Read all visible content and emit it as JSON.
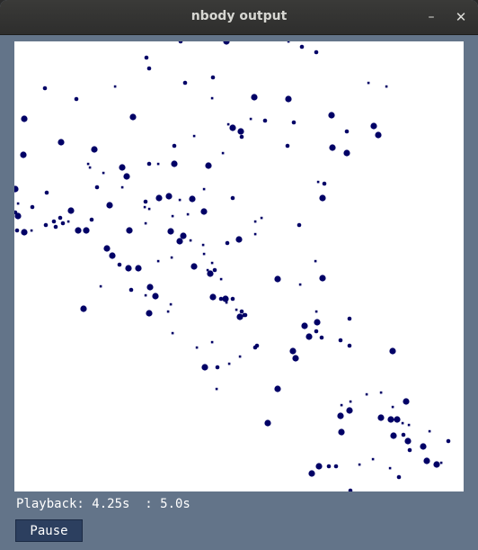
{
  "window": {
    "title": "nbody output",
    "minimize_glyph": "–",
    "close_glyph": "✕"
  },
  "simulation": {
    "body_color": "#000066",
    "bodies": [
      [
        185,
        0,
        2
      ],
      [
        236,
        0,
        3
      ],
      [
        305,
        0,
        1
      ],
      [
        320,
        6,
        2
      ],
      [
        336,
        12,
        2
      ],
      [
        147,
        18,
        2
      ],
      [
        150,
        30,
        2
      ],
      [
        221,
        40,
        2
      ],
      [
        190,
        46,
        2
      ],
      [
        34,
        52,
        2
      ],
      [
        112,
        50,
        1
      ],
      [
        69,
        64,
        2
      ],
      [
        267,
        62,
        3
      ],
      [
        305,
        64,
        3
      ],
      [
        220,
        63,
        1
      ],
      [
        11,
        86,
        3
      ],
      [
        311,
        90,
        2
      ],
      [
        132,
        84,
        3
      ],
      [
        279,
        88,
        2
      ],
      [
        263,
        86,
        1
      ],
      [
        238,
        92,
        1
      ],
      [
        243,
        96,
        3
      ],
      [
        252,
        100,
        3
      ],
      [
        400,
        94,
        3
      ],
      [
        405,
        104,
        3
      ],
      [
        394,
        46,
        1
      ],
      [
        414,
        50,
        1
      ],
      [
        370,
        100,
        2
      ],
      [
        353,
        82,
        3
      ],
      [
        354,
        118,
        3
      ],
      [
        253,
        106,
        2
      ],
      [
        52,
        112,
        3
      ],
      [
        89,
        120,
        3
      ],
      [
        10,
        126,
        3
      ],
      [
        178,
        116,
        2
      ],
      [
        200,
        105,
        1
      ],
      [
        216,
        138,
        3
      ],
      [
        232,
        124,
        1
      ],
      [
        304,
        116,
        2
      ],
      [
        370,
        124,
        3
      ],
      [
        82,
        136,
        1
      ],
      [
        84,
        140,
        1
      ],
      [
        120,
        140,
        3
      ],
      [
        150,
        136,
        2
      ],
      [
        125,
        150,
        3
      ],
      [
        160,
        136,
        1
      ],
      [
        178,
        136,
        3
      ],
      [
        99,
        146,
        1
      ],
      [
        92,
        162,
        2
      ],
      [
        120,
        162,
        1
      ],
      [
        36,
        168,
        2
      ],
      [
        1,
        164,
        3
      ],
      [
        211,
        164,
        1
      ],
      [
        243,
        174,
        2
      ],
      [
        338,
        156,
        1
      ],
      [
        345,
        158,
        2
      ],
      [
        343,
        174,
        3
      ],
      [
        106,
        182,
        3
      ],
      [
        146,
        178,
        2
      ],
      [
        161,
        174,
        3
      ],
      [
        145,
        184,
        1
      ],
      [
        150,
        186,
        1
      ],
      [
        172,
        172,
        3
      ],
      [
        184,
        176,
        1
      ],
      [
        198,
        175,
        3
      ],
      [
        4,
        180,
        1
      ],
      [
        20,
        184,
        2
      ],
      [
        63,
        188,
        3
      ],
      [
        86,
        198,
        2
      ],
      [
        176,
        194,
        1
      ],
      [
        193,
        192,
        1
      ],
      [
        211,
        189,
        3
      ],
      [
        268,
        200,
        1
      ],
      [
        275,
        196,
        1
      ],
      [
        317,
        204,
        2
      ],
      [
        1,
        190,
        2
      ],
      [
        4,
        194,
        3
      ],
      [
        44,
        200,
        2
      ],
      [
        51,
        196,
        2
      ],
      [
        3,
        210,
        2
      ],
      [
        11,
        212,
        3
      ],
      [
        19,
        210,
        1
      ],
      [
        35,
        204,
        2
      ],
      [
        46,
        206,
        2
      ],
      [
        54,
        202,
        2
      ],
      [
        60,
        200,
        1
      ],
      [
        71,
        210,
        3
      ],
      [
        80,
        210,
        3
      ],
      [
        128,
        210,
        3
      ],
      [
        146,
        202,
        1
      ],
      [
        174,
        211,
        3
      ],
      [
        184,
        222,
        3
      ],
      [
        188,
        216,
        3
      ],
      [
        196,
        221,
        1
      ],
      [
        210,
        226,
        1
      ],
      [
        237,
        224,
        2
      ],
      [
        250,
        220,
        3
      ],
      [
        268,
        214,
        1
      ],
      [
        103,
        230,
        3
      ],
      [
        109,
        238,
        3
      ],
      [
        117,
        248,
        2
      ],
      [
        127,
        252,
        3
      ],
      [
        138,
        252,
        3
      ],
      [
        160,
        244,
        1
      ],
      [
        175,
        240,
        1
      ],
      [
        200,
        250,
        3
      ],
      [
        211,
        236,
        1
      ],
      [
        220,
        246,
        1
      ],
      [
        215,
        254,
        1
      ],
      [
        218,
        258,
        3
      ],
      [
        223,
        254,
        2
      ],
      [
        230,
        264,
        1
      ],
      [
        293,
        264,
        3
      ],
      [
        318,
        270,
        1
      ],
      [
        335,
        244,
        1
      ],
      [
        343,
        263,
        3
      ],
      [
        96,
        272,
        1
      ],
      [
        130,
        276,
        2
      ],
      [
        151,
        273,
        3
      ],
      [
        157,
        283,
        3
      ],
      [
        146,
        282,
        1
      ],
      [
        221,
        284,
        3
      ],
      [
        230,
        286,
        2
      ],
      [
        235,
        286,
        3
      ],
      [
        243,
        286,
        2
      ],
      [
        77,
        297,
        3
      ],
      [
        150,
        302,
        3
      ],
      [
        171,
        300,
        1
      ],
      [
        174,
        292,
        1
      ],
      [
        236,
        290,
        1
      ],
      [
        247,
        298,
        1
      ],
      [
        251,
        306,
        3
      ],
      [
        253,
        300,
        2
      ],
      [
        257,
        304,
        2
      ],
      [
        336,
        300,
        1
      ],
      [
        337,
        312,
        3
      ],
      [
        373,
        308,
        2
      ],
      [
        176,
        324,
        1
      ],
      [
        203,
        340,
        1
      ],
      [
        220,
        334,
        1
      ],
      [
        256,
        304,
        2
      ],
      [
        323,
        316,
        3
      ],
      [
        336,
        322,
        2
      ],
      [
        328,
        328,
        3
      ],
      [
        342,
        329,
        2
      ],
      [
        363,
        332,
        2
      ],
      [
        373,
        338,
        2
      ],
      [
        268,
        340,
        2
      ],
      [
        251,
        350,
        1
      ],
      [
        226,
        362,
        2
      ],
      [
        239,
        358,
        1
      ],
      [
        270,
        338,
        2
      ],
      [
        310,
        344,
        3
      ],
      [
        313,
        352,
        3
      ],
      [
        421,
        344,
        3
      ],
      [
        212,
        362,
        3
      ],
      [
        225,
        386,
        1
      ],
      [
        293,
        386,
        3
      ],
      [
        282,
        424,
        3
      ],
      [
        421,
        406,
        1
      ],
      [
        436,
        400,
        3
      ],
      [
        392,
        392,
        1
      ],
      [
        408,
        390,
        1
      ],
      [
        408,
        418,
        3
      ],
      [
        364,
        404,
        1
      ],
      [
        363,
        416,
        3
      ],
      [
        373,
        410,
        3
      ],
      [
        374,
        400,
        1
      ],
      [
        419,
        420,
        3
      ],
      [
        426,
        420,
        3
      ],
      [
        432,
        424,
        1
      ],
      [
        439,
        426,
        1
      ],
      [
        422,
        438,
        3
      ],
      [
        433,
        437,
        2
      ],
      [
        438,
        444,
        3
      ],
      [
        462,
        433,
        1
      ],
      [
        483,
        444,
        2
      ],
      [
        440,
        454,
        2
      ],
      [
        455,
        450,
        3
      ],
      [
        459,
        466,
        3
      ],
      [
        470,
        470,
        3
      ],
      [
        475,
        468,
        1
      ],
      [
        364,
        434,
        3
      ],
      [
        358,
        472,
        2
      ],
      [
        350,
        472,
        2
      ],
      [
        339,
        472,
        3
      ],
      [
        331,
        480,
        3
      ],
      [
        384,
        470,
        1
      ],
      [
        399,
        464,
        1
      ],
      [
        418,
        474,
        1
      ],
      [
        428,
        484,
        2
      ],
      [
        374,
        499,
        2
      ]
    ]
  },
  "status": {
    "text": "Playback: 4.25s  : 5.0s"
  },
  "controls": {
    "pause_label": "Pause"
  }
}
